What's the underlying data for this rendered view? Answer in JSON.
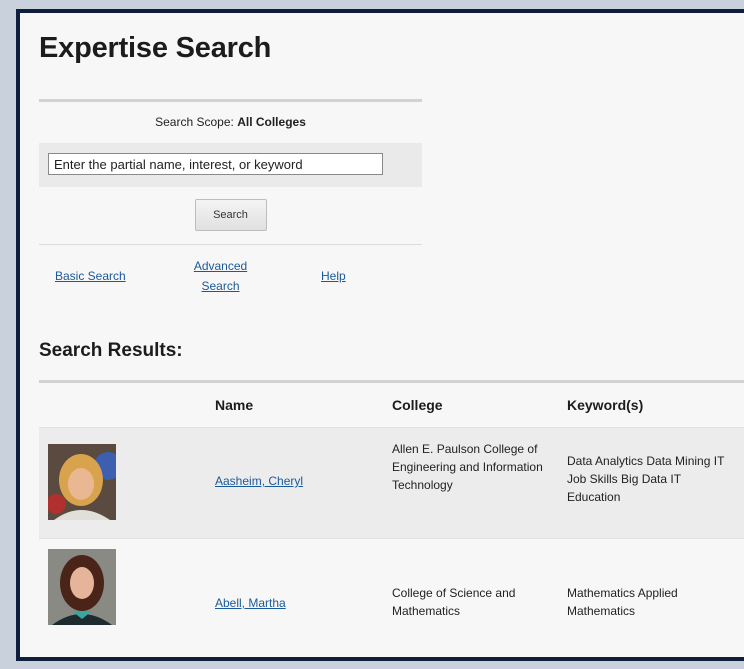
{
  "page": {
    "title": "Expertise Search"
  },
  "search": {
    "scope_label": "Search Scope:",
    "scope_value": "All Colleges",
    "placeholder": "Enter the partial name, interest, or keyword",
    "button_label": "Search"
  },
  "links": {
    "basic": "Basic Search",
    "advanced": "Advanced Search",
    "help": "Help"
  },
  "results": {
    "title": "Search Results:",
    "columns": {
      "name": "Name",
      "college": "College",
      "keywords": "Keyword(s)"
    },
    "rows": [
      {
        "name": "Aasheim, Cheryl",
        "college": "Allen E. Paulson College of Engineering and Information Technology",
        "keywords": "Data Analytics Data Mining IT Job Skills Big Data IT Education"
      },
      {
        "name": "Abell, Martha",
        "college": "College of Science and Mathematics",
        "keywords": "Mathematics Applied Mathematics"
      }
    ]
  }
}
